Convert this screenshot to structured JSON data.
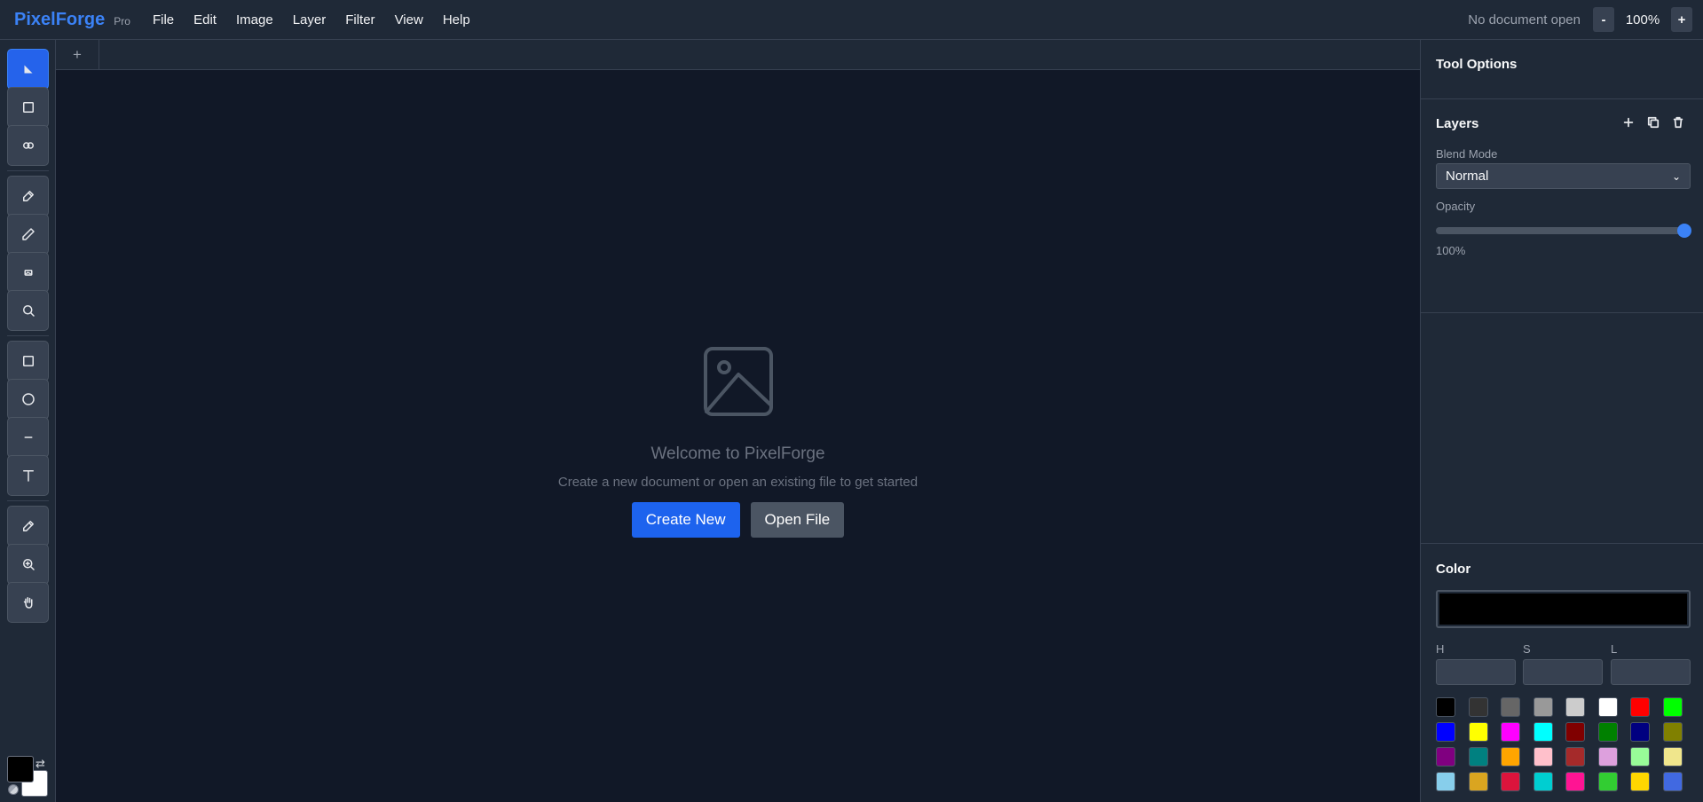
{
  "brand": {
    "name": "PixelForge",
    "badge": "Pro"
  },
  "menu": [
    "File",
    "Edit",
    "Image",
    "Layer",
    "Filter",
    "View",
    "Help"
  ],
  "status": {
    "document": "No document open",
    "zoom": "100%",
    "zoom_out": "-",
    "zoom_in": "+"
  },
  "tabs": {
    "new_tab": "+"
  },
  "tools": [
    {
      "name": "select-tool-icon",
      "active": true
    },
    {
      "name": "rect-select-tool-icon"
    },
    {
      "name": "lasso-tool-icon"
    },
    {
      "name": "brush-tool-icon"
    },
    {
      "name": "pencil-tool-icon"
    },
    {
      "name": "eraser-tool-icon"
    },
    {
      "name": "magnify-tool-icon"
    },
    {
      "name": "rectangle-tool-icon"
    },
    {
      "name": "ellipse-tool-icon"
    },
    {
      "name": "line-tool-icon"
    },
    {
      "name": "text-tool-icon"
    },
    {
      "name": "eyedropper-tool-icon"
    },
    {
      "name": "zoom-tool-icon"
    },
    {
      "name": "hand-tool-icon"
    }
  ],
  "swatches": {
    "foreground": "#000000",
    "background": "#ffffff",
    "swap": "⇄"
  },
  "welcome": {
    "title": "Welcome to PixelForge",
    "subtitle": "Create a new document or open an existing file to get started",
    "create_label": "Create New",
    "open_label": "Open File"
  },
  "panel": {
    "tool_options_title": "Tool Options",
    "layers": {
      "title": "Layers",
      "blend_label": "Blend Mode",
      "blend_value": "Normal",
      "opacity_label": "Opacity",
      "opacity_value": "100%",
      "opacity_fraction": 1.0
    },
    "color": {
      "title": "Color",
      "current": "#000000",
      "h_label": "H",
      "s_label": "S",
      "l_label": "L",
      "h_value": "",
      "s_value": "",
      "l_value": "",
      "palette": [
        "#000000",
        "#333333",
        "#666666",
        "#999999",
        "#cccccc",
        "#ffffff",
        "#ff0000",
        "#00ff00",
        "#0000ff",
        "#ffff00",
        "#ff00ff",
        "#00ffff",
        "#800000",
        "#008000",
        "#000080",
        "#808000",
        "#800080",
        "#008080",
        "#ffa500",
        "#ffc0cb",
        "#a52a2a",
        "#dda0dd",
        "#98fb98",
        "#f0e68c",
        "#87ceeb",
        "#daa520",
        "#dc143c",
        "#00ced1",
        "#ff1493",
        "#32cd32",
        "#ffd700",
        "#4169e1"
      ]
    }
  }
}
